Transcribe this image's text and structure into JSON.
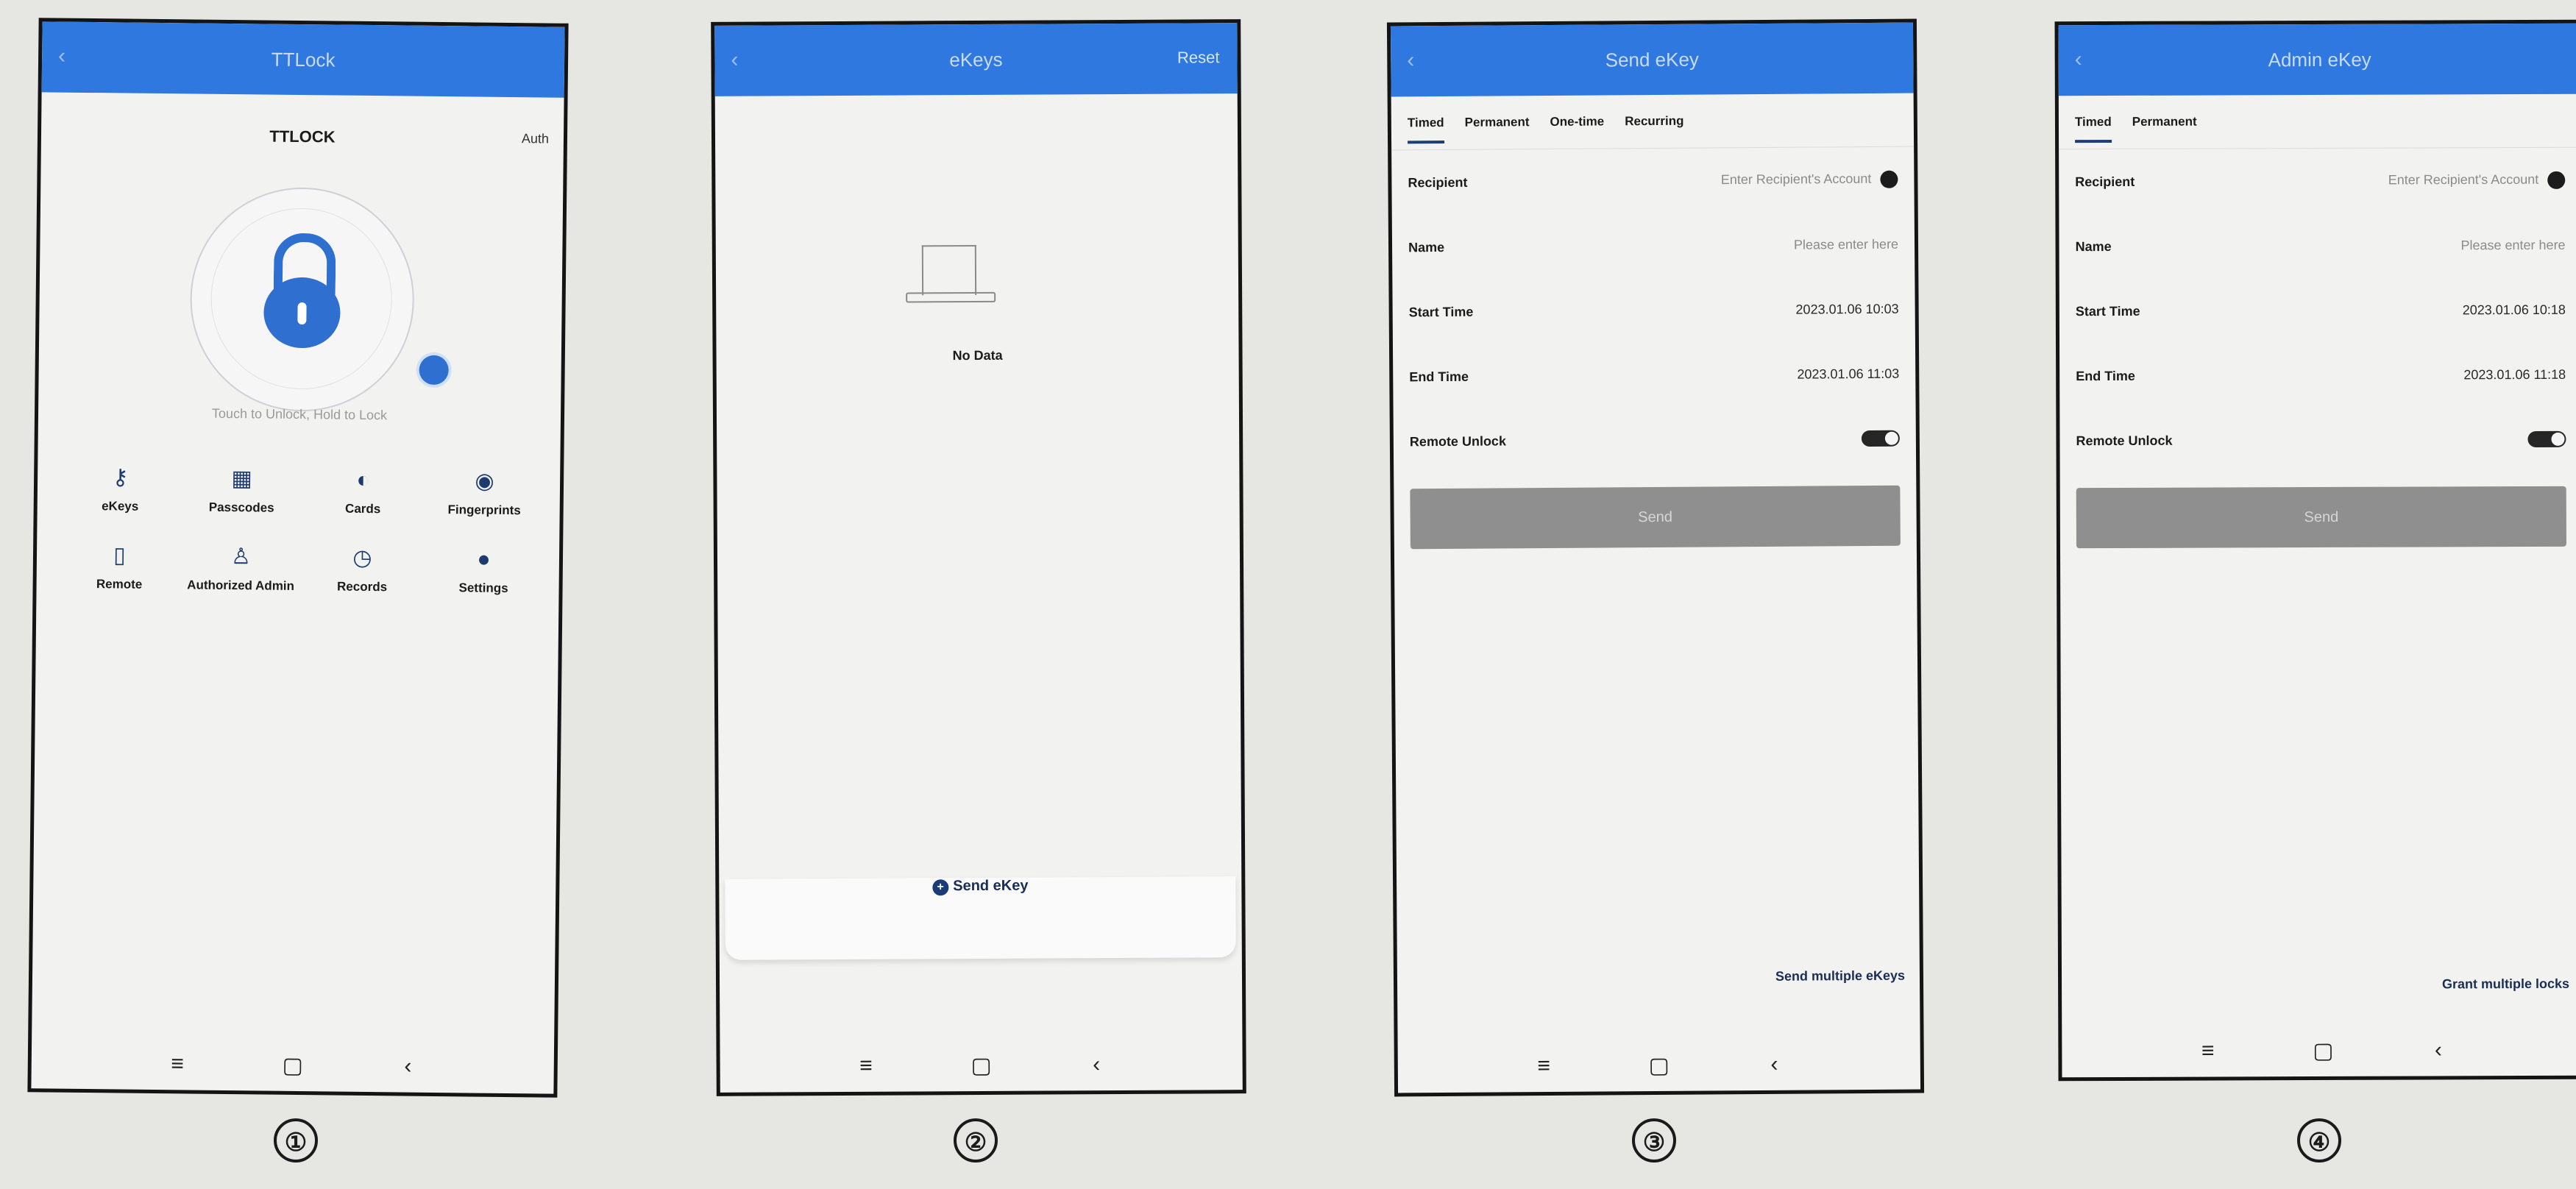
{
  "screen1": {
    "header_title": "TTLock",
    "lock_name": "TTLOCK",
    "auth_label": "Auth",
    "hint": "Touch to Unlock, Hold to Lock",
    "menu": [
      {
        "label": "eKeys",
        "icon": "key-icon"
      },
      {
        "label": "Passcodes",
        "icon": "keypad-icon"
      },
      {
        "label": "Cards",
        "icon": "card-icon"
      },
      {
        "label": "Fingerprints",
        "icon": "fingerprint-icon"
      },
      {
        "label": "Remote",
        "icon": "remote-icon"
      },
      {
        "label": "Authorized Admin",
        "icon": "admin-icon"
      },
      {
        "label": "Records",
        "icon": "records-icon"
      },
      {
        "label": "Settings",
        "icon": "settings-icon"
      }
    ]
  },
  "screen2": {
    "header_title": "eKeys",
    "header_right": "Reset",
    "empty_text": "No Data",
    "send_button": "Send eKey"
  },
  "screen3": {
    "header_title": "Send eKey",
    "tabs": [
      "Timed",
      "Permanent",
      "One-time",
      "Recurring"
    ],
    "active_tab": "Timed",
    "recipient_label": "Recipient",
    "recipient_placeholder": "Enter Recipient's Account",
    "name_label": "Name",
    "name_placeholder": "Please enter here",
    "start_label": "Start Time",
    "start_value": "2023.01.06 10:03",
    "end_label": "End Time",
    "end_value": "2023.01.06 11:03",
    "remote_label": "Remote Unlock",
    "send_button": "Send",
    "footer_link": "Send multiple eKeys"
  },
  "screen4": {
    "header_title": "Admin eKey",
    "tabs": [
      "Timed",
      "Permanent"
    ],
    "active_tab": "Timed",
    "recipient_label": "Recipient",
    "recipient_placeholder": "Enter Recipient's Account",
    "name_label": "Name",
    "name_placeholder": "Please enter here",
    "start_label": "Start Time",
    "start_value": "2023.01.06 10:18",
    "end_label": "End Time",
    "end_value": "2023.01.06 11:18",
    "remote_label": "Remote Unlock",
    "send_button": "Send",
    "footer_link": "Grant multiple locks"
  },
  "navbar": {
    "menu": "≡",
    "home": "▢",
    "back": "‹"
  },
  "page_numbers": [
    "①",
    "②",
    "③",
    "④"
  ]
}
